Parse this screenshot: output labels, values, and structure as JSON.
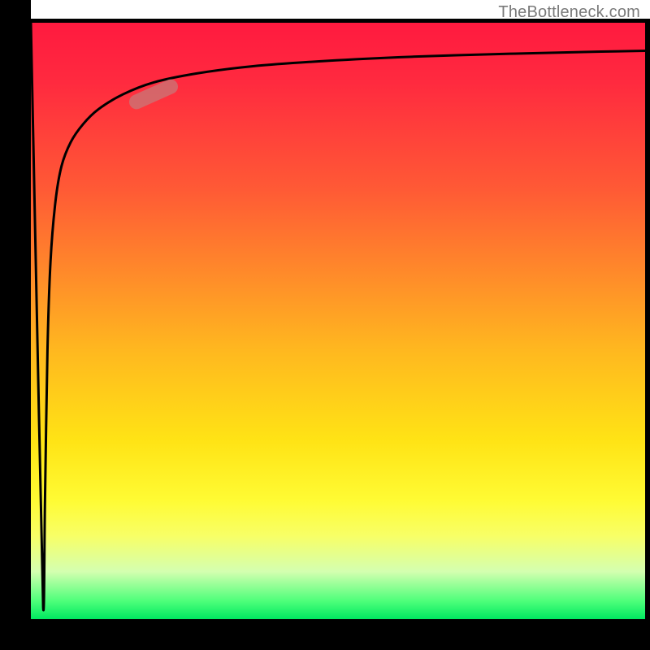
{
  "watermark": "TheBottleneck.com",
  "chart_data": {
    "type": "line",
    "title": "",
    "xlabel": "",
    "ylabel": "",
    "xlim": [
      0,
      100
    ],
    "ylim": [
      0,
      100
    ],
    "grid": false,
    "legend": false,
    "series": [
      {
        "name": "bottleneck-curve",
        "x": [
          0,
          1.2,
          2.0,
          2.3,
          2.7,
          3.2,
          4.0,
          5.0,
          6.5,
          8.5,
          11,
          15,
          20,
          27,
          36,
          48,
          62,
          78,
          90,
          100
        ],
        "values": [
          100,
          40,
          2,
          20,
          45,
          60,
          70,
          76,
          80,
          83,
          85.5,
          88,
          90,
          91.5,
          92.7,
          93.6,
          94.3,
          94.8,
          95.1,
          95.3
        ]
      }
    ],
    "marker": {
      "x": 20,
      "y": 88,
      "angle_deg": -24
    },
    "background_gradient": {
      "top": "#ff1a3f",
      "mid": "#ffe315",
      "bottom": "#00e860"
    }
  }
}
